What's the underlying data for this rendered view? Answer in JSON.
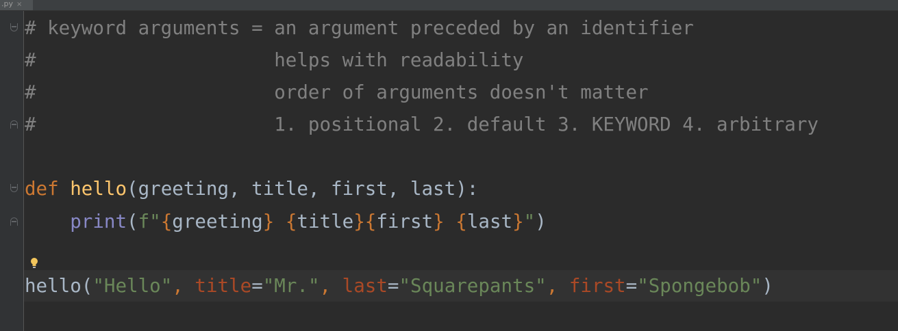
{
  "tab": {
    "label": ".py",
    "close": "×"
  },
  "code": {
    "comments": [
      "# keyword arguments = an argument preceded by an identifier",
      "#                     helps with readability",
      "#                     order of arguments doesn't matter",
      "#                     1. positional 2. default 3. KEYWORD 4. arbitrary"
    ],
    "def_line": {
      "keyword": "def",
      "space": " ",
      "name": "hello",
      "open": "(",
      "params": "greeting, title, first, last",
      "close": "):"
    },
    "print_line": {
      "indent": "    ",
      "builtin": "print",
      "open": "(",
      "fprefix": "f\"",
      "b1": "{",
      "v1": "greeting",
      "b2": "}",
      "sp1": " ",
      "b3": "{",
      "v2": "title",
      "b4": "}",
      "b5": "{",
      "v3": "first",
      "b6": "}",
      "sp2": " ",
      "b7": "{",
      "v4": "last",
      "b8": "}",
      "fend": "\"",
      "close": ")"
    },
    "call_line": {
      "name": "hello",
      "open": "(",
      "arg1": "\"Hello\"",
      "c1": ", ",
      "kw1": "title",
      "eq1": "=",
      "val1": "\"Mr.\"",
      "c2": ", ",
      "kw2": "last",
      "eq2": "=",
      "val2": "\"Squarepants\"",
      "c3": ", ",
      "kw3": "first",
      "eq3": "=",
      "val3": "\"Spongebob\"",
      "close": ")"
    }
  },
  "colors": {
    "background": "#2b2b2b",
    "comment": "#808080",
    "keyword": "#cc7832",
    "function": "#ffc66d",
    "builtin": "#8888c6",
    "string": "#6a8759",
    "named_argument": "#aa4926",
    "text": "#a9b7c6"
  },
  "icons": [
    "fold-marker-icon",
    "intention-bulb-icon"
  ]
}
